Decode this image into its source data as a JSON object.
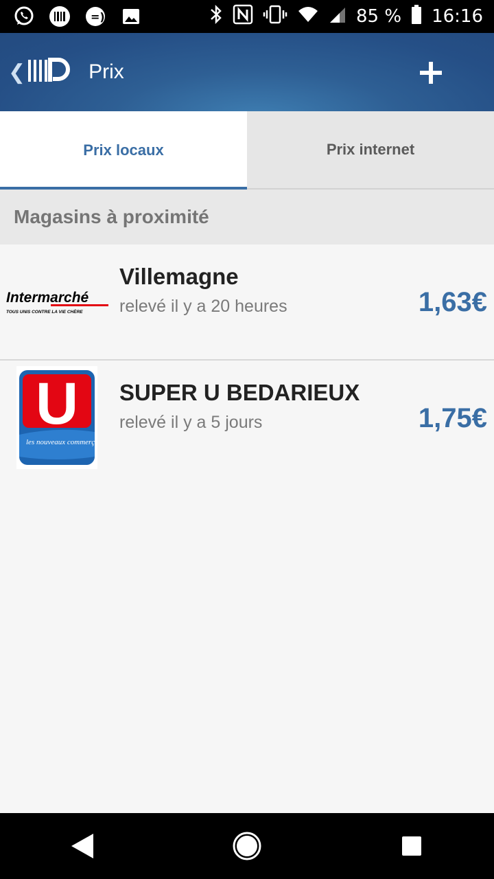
{
  "status_bar": {
    "battery": "85 %",
    "time": "16:16",
    "icons": [
      "whatsapp-icon",
      "barcode-icon",
      "chat-bubble-icon",
      "image-icon",
      "bluetooth-icon",
      "nfc-icon",
      "vibrate-icon",
      "wifi-icon",
      "signal-icon",
      "battery-icon"
    ]
  },
  "app_bar": {
    "title": "Prix",
    "back_icon": "back-chevron-icon",
    "logo_icon": "app-logo-icon",
    "add_icon": "plus-icon"
  },
  "tabs": [
    {
      "label": "Prix locaux",
      "active": true
    },
    {
      "label": "Prix internet",
      "active": false
    }
  ],
  "section": {
    "title": "Magasins à proximité"
  },
  "stores": [
    {
      "name": "Villemagne",
      "subtitle": "relevé il y a 20 heures",
      "price": "1,63€",
      "logo": "intermarche-logo",
      "logo_text": "Intermarché",
      "logo_tagline": "TOUS UNIS CONTRE LA VIE CHÈRE"
    },
    {
      "name": "SUPER U BEDARIEUX",
      "subtitle": "relevé il y a 5 jours",
      "price": "1,75€",
      "logo": "super-u-logo",
      "logo_text": "U",
      "logo_tagline": "les nouveaux commerçants"
    }
  ],
  "nav_bar": {
    "icons": [
      "back-triangle-icon",
      "home-circle-icon",
      "recents-square-icon"
    ]
  },
  "colors": {
    "accent": "#3a6ea5",
    "appbar": "#2e5f94",
    "price": "#3a6ea5"
  }
}
